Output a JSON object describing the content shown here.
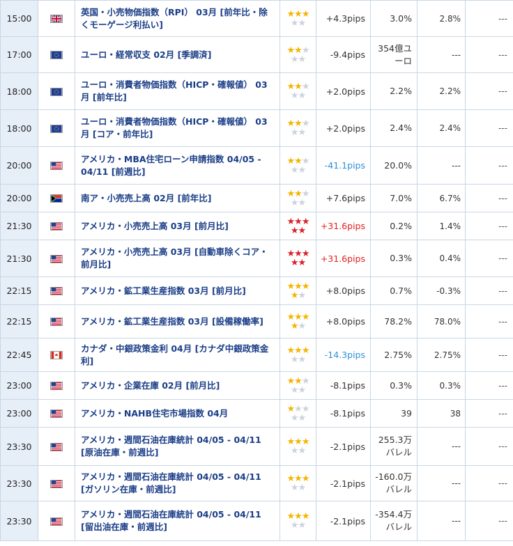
{
  "colors": {
    "star": "#f4b400",
    "star_high": "#d9202a",
    "plus_high": "#e02020",
    "minus_blue": "#2b8fd8",
    "name": "#1a3d87"
  },
  "rows": [
    {
      "time": "15:00",
      "flag": "uk-flag-icon",
      "name": "英国・小売物価指数（RPI） 03月 [前年比・除くモーゲージ利払い]",
      "stars": 3,
      "star_style": "gold",
      "pips": "+4.3pips",
      "pips_style": "normal",
      "forecast": "3.0%",
      "previous": "2.8%",
      "actual": "---"
    },
    {
      "time": "17:00",
      "flag": "eu-flag-icon",
      "name": "ユーロ・経常収支 02月 [季調済]",
      "stars": 2,
      "star_style": "gold",
      "pips": "-9.4pips",
      "pips_style": "normal",
      "forecast": "354億ユーロ",
      "previous": "---",
      "actual": "---"
    },
    {
      "time": "18:00",
      "flag": "eu-flag-icon",
      "name": "ユーロ・消費者物価指数（HICP・確報値） 03月 [前年比]",
      "stars": 2,
      "star_style": "gold",
      "pips": "+2.0pips",
      "pips_style": "normal",
      "forecast": "2.2%",
      "previous": "2.2%",
      "actual": "---"
    },
    {
      "time": "18:00",
      "flag": "eu-flag-icon",
      "name": "ユーロ・消費者物価指数（HICP・確報値） 03月 [コア・前年比]",
      "stars": 2,
      "star_style": "gold",
      "pips": "+2.0pips",
      "pips_style": "normal",
      "forecast": "2.4%",
      "previous": "2.4%",
      "actual": "---"
    },
    {
      "time": "20:00",
      "flag": "us-flag-icon",
      "name": "アメリカ・MBA住宅ローン申請指数 04/05 - 04/11 [前週比]",
      "stars": 2,
      "star_style": "gold",
      "pips": "-41.1pips",
      "pips_style": "blue",
      "forecast": "20.0%",
      "previous": "---",
      "actual": "---"
    },
    {
      "time": "20:00",
      "flag": "za-flag-icon",
      "name": "南ア・小売売上高 02月 [前年比]",
      "stars": 2,
      "star_style": "gold",
      "pips": "+7.6pips",
      "pips_style": "normal",
      "forecast": "7.0%",
      "previous": "6.7%",
      "actual": "---"
    },
    {
      "time": "21:30",
      "flag": "us-flag-icon",
      "name": "アメリカ・小売売上高 03月 [前月比]",
      "stars": 5,
      "star_style": "red",
      "pips": "+31.6pips",
      "pips_style": "red",
      "forecast": "0.2%",
      "previous": "1.4%",
      "actual": "---"
    },
    {
      "time": "21:30",
      "flag": "us-flag-icon",
      "name": "アメリカ・小売売上高 03月 [自動車除くコア・前月比]",
      "stars": 5,
      "star_style": "red",
      "pips": "+31.6pips",
      "pips_style": "red",
      "forecast": "0.3%",
      "previous": "0.4%",
      "actual": "---"
    },
    {
      "time": "22:15",
      "flag": "us-flag-icon",
      "name": "アメリカ・鉱工業生産指数 03月 [前月比]",
      "stars": 4,
      "star_style": "gold",
      "pips": "+8.0pips",
      "pips_style": "normal",
      "forecast": "0.7%",
      "previous": "-0.3%",
      "actual": "---"
    },
    {
      "time": "22:15",
      "flag": "us-flag-icon",
      "name": "アメリカ・鉱工業生産指数 03月 [設備稼働率]",
      "stars": 4,
      "star_style": "gold",
      "pips": "+8.0pips",
      "pips_style": "normal",
      "forecast": "78.2%",
      "previous": "78.0%",
      "actual": "---"
    },
    {
      "time": "22:45",
      "flag": "ca-flag-icon",
      "name": "カナダ・中銀政策金利 04月 [カナダ中銀政策金利]",
      "stars": 3,
      "star_style": "gold",
      "pips": "-14.3pips",
      "pips_style": "blue",
      "forecast": "2.75%",
      "previous": "2.75%",
      "actual": "---"
    },
    {
      "time": "23:00",
      "flag": "us-flag-icon",
      "name": "アメリカ・企業在庫 02月 [前月比]",
      "stars": 2,
      "star_style": "gold",
      "pips": "-8.1pips",
      "pips_style": "normal",
      "forecast": "0.3%",
      "previous": "0.3%",
      "actual": "---"
    },
    {
      "time": "23:00",
      "flag": "us-flag-icon",
      "name": "アメリカ・NAHB住宅市場指数 04月",
      "stars": 1,
      "star_style": "gold",
      "pips": "-8.1pips",
      "pips_style": "normal",
      "forecast": "39",
      "previous": "38",
      "actual": "---"
    },
    {
      "time": "23:30",
      "flag": "us-flag-icon",
      "name": "アメリカ・週間石油在庫統計 04/05 - 04/11 [原油在庫・前週比]",
      "stars": 3,
      "star_style": "gold",
      "pips": "-2.1pips",
      "pips_style": "normal",
      "forecast": "255.3万バレル",
      "previous": "---",
      "actual": "---"
    },
    {
      "time": "23:30",
      "flag": "us-flag-icon",
      "name": "アメリカ・週間石油在庫統計 04/05 - 04/11 [ガソリン在庫・前週比]",
      "stars": 3,
      "star_style": "gold",
      "pips": "-2.1pips",
      "pips_style": "normal",
      "forecast": "-160.0万バレル",
      "previous": "---",
      "actual": "---"
    },
    {
      "time": "23:30",
      "flag": "us-flag-icon",
      "name": "アメリカ・週間石油在庫統計 04/05 - 04/11 [留出油在庫・前週比]",
      "stars": 3,
      "star_style": "gold",
      "pips": "-2.1pips",
      "pips_style": "normal",
      "forecast": "-354.4万バレル",
      "previous": "---",
      "actual": "---"
    }
  ]
}
